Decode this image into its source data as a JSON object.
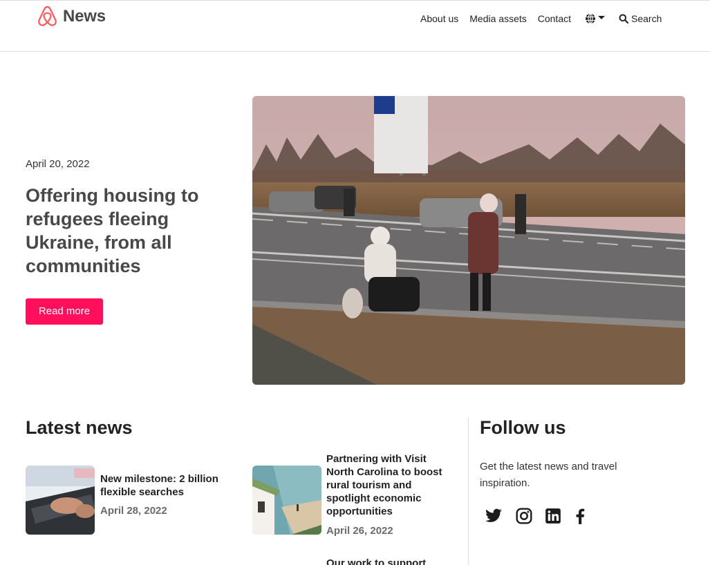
{
  "header": {
    "brand": "News",
    "nav": {
      "about": "About us",
      "media": "Media assets",
      "contact": "Contact",
      "search": "Search"
    }
  },
  "hero": {
    "date": "April 20, 2022",
    "title": "Offering housing to refugees fleeing Ukraine, from all communities",
    "cta": "Read more"
  },
  "latest": {
    "heading": "Latest news",
    "items": [
      {
        "title": "New milestone: 2 billion flexible searches",
        "date": "April 28, 2022"
      },
      {
        "title": "Partnering with Visit North Carolina to boost rural tourism and spotlight economic opportunities",
        "date": "April 26, 2022"
      },
      {
        "title": "Our work to support",
        "date": ""
      }
    ]
  },
  "follow": {
    "heading": "Follow us",
    "text": "Get the latest news and travel inspiration.",
    "socials": [
      "twitter-icon",
      "instagram-icon",
      "linkedin-icon",
      "facebook-icon"
    ]
  },
  "colors": {
    "brand": "#ff5a5f",
    "cta": "#ff0f5c",
    "text": "#222222",
    "muted": "#6b6b6b"
  }
}
